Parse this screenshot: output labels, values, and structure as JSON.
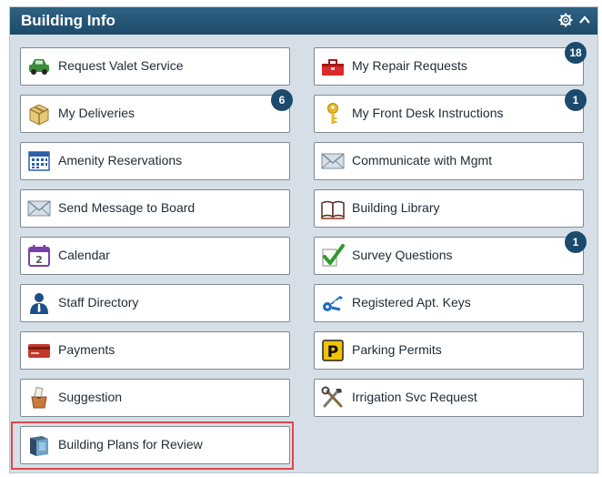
{
  "header": {
    "title": "Building Info",
    "settings_icon": "gear-icon",
    "collapse_icon": "chevron-up-icon"
  },
  "colors": {
    "header": "#24557a",
    "panel_bg": "#d6dfe7",
    "badge": "#1b4a6c",
    "highlight": "#e0474a"
  },
  "left_tiles": [
    {
      "label": "Request Valet Service",
      "icon": "car-icon"
    },
    {
      "label": "My Deliveries",
      "icon": "package-icon",
      "badge": "6"
    },
    {
      "label": "Amenity Reservations",
      "icon": "calendar-grid-icon"
    },
    {
      "label": "Send Message to Board",
      "icon": "envelope-icon"
    },
    {
      "label": "Calendar",
      "icon": "calendar-icon"
    },
    {
      "label": "Staff Directory",
      "icon": "person-icon"
    },
    {
      "label": "Payments",
      "icon": "credit-card-icon"
    },
    {
      "label": "Suggestion",
      "icon": "suggestion-box-icon"
    },
    {
      "label": "Building Plans for Review",
      "icon": "book-icon",
      "highlighted": true
    }
  ],
  "right_tiles": [
    {
      "label": "My Repair Requests",
      "icon": "toolbox-icon",
      "badge": "18"
    },
    {
      "label": "My Front Desk Instructions",
      "icon": "key-icon",
      "badge": "1"
    },
    {
      "label": "Communicate with Mgmt",
      "icon": "envelope-icon"
    },
    {
      "label": "Building Library",
      "icon": "open-book-icon"
    },
    {
      "label": "Survey Questions",
      "icon": "checkmark-icon",
      "badge": "1"
    },
    {
      "label": "Registered Apt. Keys",
      "icon": "keys-icon"
    },
    {
      "label": "Parking Permits",
      "icon": "parking-icon"
    },
    {
      "label": "Irrigation Svc Request",
      "icon": "tools-icon"
    }
  ]
}
